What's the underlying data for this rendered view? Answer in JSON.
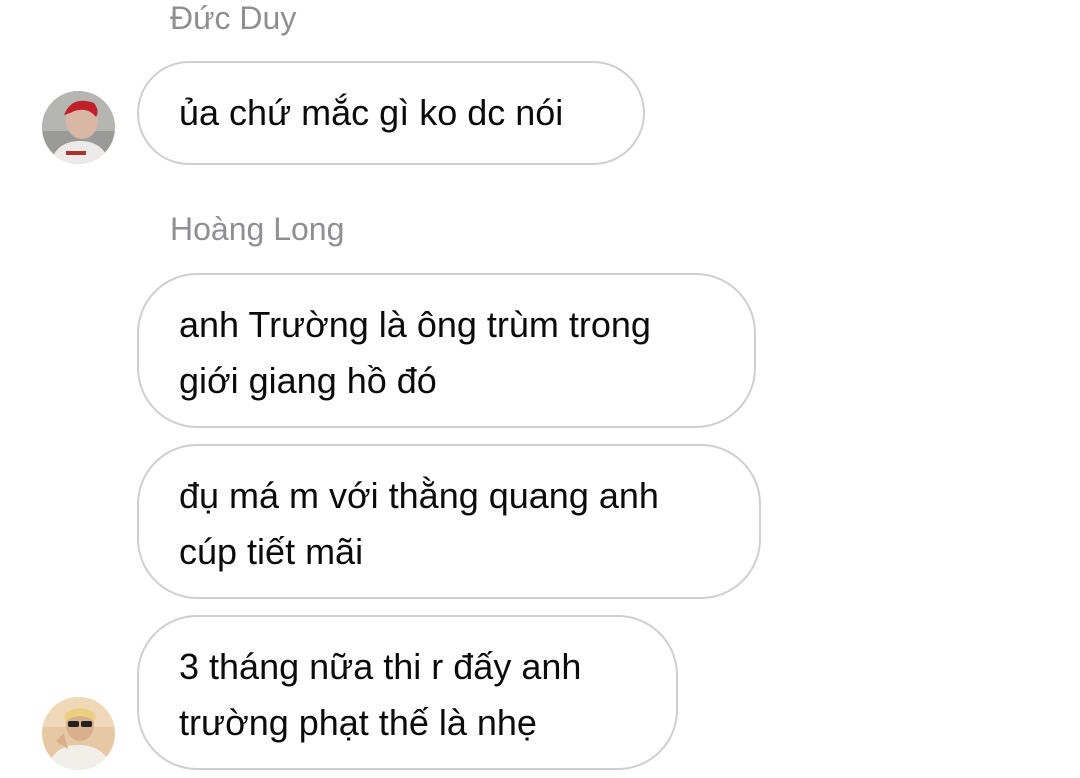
{
  "conversation": {
    "groups": [
      {
        "sender": "Đức Duy",
        "messages": [
          {
            "lines": [
              "ủa chứ mắc gì ko dc nói"
            ]
          }
        ]
      },
      {
        "sender": "Hoàng Long",
        "messages": [
          {
            "lines": [
              "anh Trường là ông trùm trong",
              "giới giang hồ đó"
            ]
          },
          {
            "lines": [
              "đụ má m với thằng quang anh",
              "cúp tiết mãi"
            ]
          },
          {
            "lines": [
              "3 tháng nữa thi r đấy anh",
              "trường phạt thế là nhẹ"
            ]
          }
        ]
      }
    ]
  },
  "colors": {
    "background": "#ffffff",
    "sender_name": "#8e8e93",
    "bubble_border": "#cfcfd3",
    "message_text": "#0b0b0b"
  },
  "icons": {
    "avatar_1": "profile-photo-red-hair",
    "avatar_2": "profile-photo-sunglasses"
  }
}
